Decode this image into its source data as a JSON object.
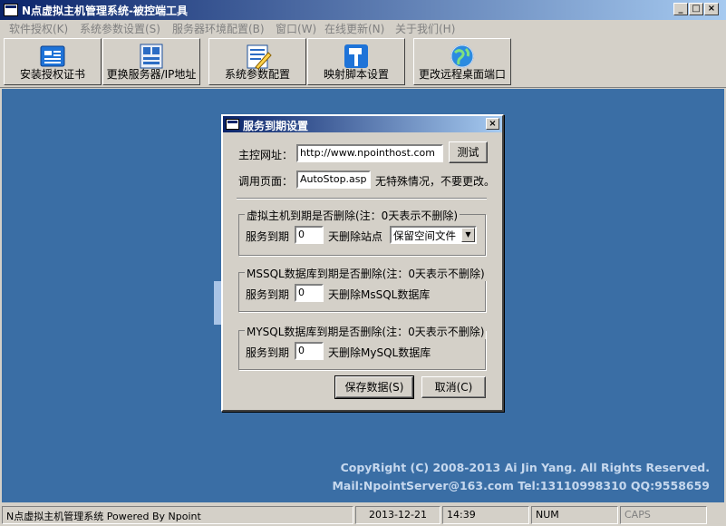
{
  "window": {
    "title": "N点虚拟主机管理系统-被控端工具",
    "controls": {
      "minimize": "_",
      "maximize": "□",
      "close": "×"
    }
  },
  "menu": [
    {
      "label": "软件授权(K)"
    },
    {
      "label": "系统参数设置(S)"
    },
    {
      "label": "服务器环境配置(B)"
    },
    {
      "label": "窗口(W)"
    },
    {
      "label": "在线更新(N)"
    },
    {
      "label": "关于我们(H)"
    }
  ],
  "toolbar": [
    {
      "label": "安装授权证书",
      "icon": "certificate-icon"
    },
    {
      "label": "更换服务器/IP地址",
      "icon": "server-icon"
    },
    {
      "label": "系统参数配置",
      "icon": "settings-document-icon"
    },
    {
      "label": "映射脚本设置",
      "icon": "hammer-icon"
    },
    {
      "label": "更改远程桌面端口",
      "icon": "globe-network-icon"
    }
  ],
  "workspace": {
    "copyright_line1": "CopyRight (C) 2008-2013 Ai Jin Yang. All Rights Reserved.",
    "copyright_line2": "Mail:NpointServer@163.com Tel:13110998310 QQ:9558659",
    "bg_color": "#3a6ea5"
  },
  "statusbar": {
    "app": "N点虚拟主机管理系统 Powered By Npoint",
    "date": "2013-12-21",
    "time": "14:39",
    "num": "NUM",
    "caps": "CAPS"
  },
  "dialog": {
    "title": "服务到期设置",
    "close": "×",
    "main_url_label": "主控网址：",
    "main_url_value": "http://www.npointhost.com",
    "test_button": "测试",
    "page_label": "调用页面：",
    "page_value": "AutoStop.asp",
    "page_hint": "无特殊情况，不要更改。",
    "host_group": {
      "legend": "虚拟主机到期是否删除(注：0天表示不删除)",
      "prefix": "服务到期",
      "days": "0",
      "suffix": "天删除站点",
      "option": "保留空间文件"
    },
    "mssql_group": {
      "legend": "MSSQL数据库到期是否删除(注：0天表示不删除)",
      "prefix": "服务到期",
      "days": "0",
      "suffix": "天删除MsSQL数据库"
    },
    "mysql_group": {
      "legend": "MYSQL数据库到期是否删除(注：0天表示不删除)",
      "prefix": "服务到期",
      "days": "0",
      "suffix": "天删除MySQL数据库"
    },
    "save_button": "保存数据(S)",
    "cancel_button": "取消(C)"
  }
}
